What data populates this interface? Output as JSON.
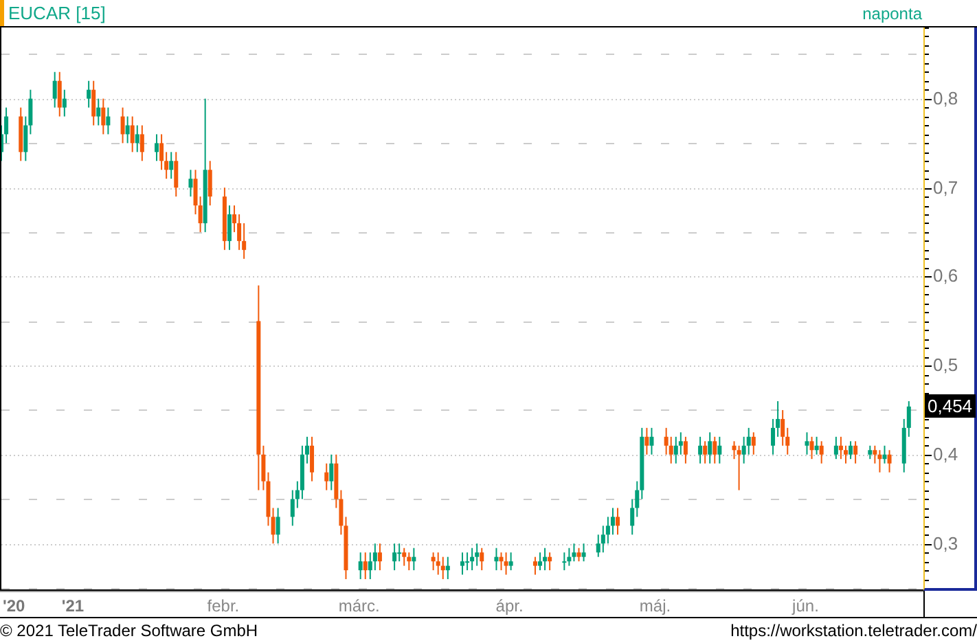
{
  "header": {
    "symbol": "EUCAR [15]",
    "interval": "naponta"
  },
  "chart": {
    "last_price": "0,454",
    "chart_data": {
      "type": "candlestick",
      "x": [
        "2020-12-17",
        "2020-12-18",
        "2020-12-21",
        "2020-12-22",
        "2020-12-23",
        "2020-12-28",
        "2020-12-29",
        "2020-12-30",
        "2021-01-04",
        "2021-01-05",
        "2021-01-06",
        "2021-01-07",
        "2021-01-08",
        "2021-01-11",
        "2021-01-12",
        "2021-01-13",
        "2021-01-14",
        "2021-01-15",
        "2021-01-18",
        "2021-01-19",
        "2021-01-20",
        "2021-01-21",
        "2021-01-22",
        "2021-01-25",
        "2021-01-26",
        "2021-01-27",
        "2021-01-28",
        "2021-01-29",
        "2021-02-01",
        "2021-02-02",
        "2021-02-03",
        "2021-02-04",
        "2021-02-05",
        "2021-02-08",
        "2021-02-09",
        "2021-02-10",
        "2021-02-11",
        "2021-02-12",
        "2021-02-15",
        "2021-02-16",
        "2021-02-17",
        "2021-02-18",
        "2021-02-19",
        "2021-02-22",
        "2021-02-23",
        "2021-02-24",
        "2021-02-25",
        "2021-02-26",
        "2021-03-01",
        "2021-03-02",
        "2021-03-03",
        "2021-03-04",
        "2021-03-05",
        "2021-03-08",
        "2021-03-09",
        "2021-03-10",
        "2021-03-11",
        "2021-03-12",
        "2021-03-16",
        "2021-03-17",
        "2021-03-18",
        "2021-03-19",
        "2021-03-22",
        "2021-03-23",
        "2021-03-24",
        "2021-03-25",
        "2021-03-26",
        "2021-03-29",
        "2021-03-30",
        "2021-03-31",
        "2021-04-01",
        "2021-04-06",
        "2021-04-07",
        "2021-04-08",
        "2021-04-09",
        "2021-04-12",
        "2021-04-13",
        "2021-04-14",
        "2021-04-15",
        "2021-04-16",
        "2021-04-19",
        "2021-04-20",
        "2021-04-21",
        "2021-04-22",
        "2021-04-23",
        "2021-04-26",
        "2021-04-27",
        "2021-04-28",
        "2021-04-29",
        "2021-04-30",
        "2021-05-03",
        "2021-05-04",
        "2021-05-05",
        "2021-05-06",
        "2021-05-07",
        "2021-05-10",
        "2021-05-11",
        "2021-05-12",
        "2021-05-13",
        "2021-05-14",
        "2021-05-17",
        "2021-05-18",
        "2021-05-19",
        "2021-05-20",
        "2021-05-21",
        "2021-05-25",
        "2021-05-26",
        "2021-05-27",
        "2021-05-28",
        "2021-06-01",
        "2021-06-02",
        "2021-06-03",
        "2021-06-04",
        "2021-06-07",
        "2021-06-08",
        "2021-06-09",
        "2021-06-10",
        "2021-06-11",
        "2021-06-14",
        "2021-06-15",
        "2021-06-16",
        "2021-06-17",
        "2021-06-18",
        "2021-06-21",
        "2021-06-22"
      ],
      "xlim": [
        "2020-12-17",
        "2021-06-25"
      ],
      "grid": true,
      "ohlc": [
        [
          0.74,
          0.77,
          0.73,
          0.76
        ],
        [
          0.76,
          0.79,
          0.75,
          0.78
        ],
        [
          0.78,
          0.79,
          0.73,
          0.74
        ],
        [
          0.74,
          0.78,
          0.73,
          0.77
        ],
        [
          0.77,
          0.81,
          0.76,
          0.8
        ],
        [
          0.8,
          0.83,
          0.79,
          0.82
        ],
        [
          0.82,
          0.83,
          0.78,
          0.79
        ],
        [
          0.79,
          0.81,
          0.78,
          0.8
        ],
        [
          0.8,
          0.82,
          0.79,
          0.81
        ],
        [
          0.81,
          0.82,
          0.77,
          0.78
        ],
        [
          0.78,
          0.8,
          0.77,
          0.79
        ],
        [
          0.79,
          0.8,
          0.76,
          0.77
        ],
        [
          0.77,
          0.79,
          0.76,
          0.78
        ],
        [
          0.78,
          0.79,
          0.75,
          0.76
        ],
        [
          0.76,
          0.78,
          0.75,
          0.77
        ],
        [
          0.77,
          0.78,
          0.74,
          0.75
        ],
        [
          0.75,
          0.77,
          0.74,
          0.76
        ],
        [
          0.76,
          0.77,
          0.73,
          0.74
        ],
        [
          0.74,
          0.76,
          0.73,
          0.75
        ],
        [
          0.75,
          0.76,
          0.72,
          0.73
        ],
        [
          0.73,
          0.74,
          0.71,
          0.72
        ],
        [
          0.72,
          0.74,
          0.71,
          0.73
        ],
        [
          0.73,
          0.74,
          0.69,
          0.7
        ],
        [
          0.7,
          0.72,
          0.69,
          0.71
        ],
        [
          0.71,
          0.72,
          0.67,
          0.68
        ],
        [
          0.68,
          0.69,
          0.65,
          0.66
        ],
        [
          0.66,
          0.8,
          0.65,
          0.72
        ],
        [
          0.72,
          0.73,
          0.68,
          0.69
        ],
        [
          0.69,
          0.7,
          0.63,
          0.64
        ],
        [
          0.64,
          0.68,
          0.63,
          0.67
        ],
        [
          0.67,
          0.68,
          0.65,
          0.66
        ],
        [
          0.66,
          0.67,
          0.63,
          0.64
        ],
        [
          0.64,
          0.66,
          0.62,
          0.63
        ],
        [
          0.55,
          0.59,
          0.36,
          0.4
        ],
        [
          0.4,
          0.41,
          0.36,
          0.37
        ],
        [
          0.37,
          0.38,
          0.32,
          0.33
        ],
        [
          0.33,
          0.34,
          0.3,
          0.31
        ],
        [
          0.31,
          0.34,
          0.3,
          0.33
        ],
        [
          0.33,
          0.36,
          0.32,
          0.35
        ],
        [
          0.35,
          0.37,
          0.34,
          0.36
        ],
        [
          0.36,
          0.41,
          0.35,
          0.4
        ],
        [
          0.4,
          0.42,
          0.39,
          0.41
        ],
        [
          0.41,
          0.42,
          0.37,
          0.38
        ],
        [
          0.38,
          0.39,
          0.36,
          0.37
        ],
        [
          0.37,
          0.4,
          0.36,
          0.39
        ],
        [
          0.39,
          0.4,
          0.34,
          0.35
        ],
        [
          0.35,
          0.36,
          0.31,
          0.32
        ],
        [
          0.32,
          0.33,
          0.26,
          0.27
        ],
        [
          0.27,
          0.29,
          0.26,
          0.28
        ],
        [
          0.28,
          0.29,
          0.26,
          0.27
        ],
        [
          0.27,
          0.29,
          0.26,
          0.28
        ],
        [
          0.28,
          0.3,
          0.27,
          0.29
        ],
        [
          0.29,
          0.3,
          0.27,
          0.28
        ],
        [
          0.28,
          0.3,
          0.27,
          0.29
        ],
        [
          0.29,
          0.3,
          0.28,
          0.29
        ],
        [
          0.29,
          0.295,
          0.275,
          0.285
        ],
        [
          0.285,
          0.29,
          0.27,
          0.28
        ],
        [
          0.28,
          0.295,
          0.27,
          0.285
        ],
        [
          0.285,
          0.29,
          0.27,
          0.28
        ],
        [
          0.28,
          0.29,
          0.265,
          0.275
        ],
        [
          0.275,
          0.285,
          0.26,
          0.27
        ],
        [
          0.27,
          0.285,
          0.26,
          0.275
        ],
        [
          0.275,
          0.29,
          0.265,
          0.28
        ],
        [
          0.28,
          0.29,
          0.27,
          0.28
        ],
        [
          0.28,
          0.295,
          0.27,
          0.285
        ],
        [
          0.285,
          0.3,
          0.275,
          0.29
        ],
        [
          0.29,
          0.295,
          0.27,
          0.28
        ],
        [
          0.28,
          0.295,
          0.27,
          0.285
        ],
        [
          0.285,
          0.29,
          0.27,
          0.28
        ],
        [
          0.28,
          0.29,
          0.265,
          0.275
        ],
        [
          0.275,
          0.29,
          0.27,
          0.28
        ],
        [
          0.28,
          0.285,
          0.265,
          0.275
        ],
        [
          0.275,
          0.29,
          0.27,
          0.28
        ],
        [
          0.28,
          0.295,
          0.27,
          0.285
        ],
        [
          0.285,
          0.29,
          0.27,
          0.28
        ],
        [
          0.28,
          0.29,
          0.27,
          0.28
        ],
        [
          0.28,
          0.295,
          0.275,
          0.285
        ],
        [
          0.285,
          0.3,
          0.28,
          0.29
        ],
        [
          0.29,
          0.295,
          0.28,
          0.285
        ],
        [
          0.285,
          0.3,
          0.28,
          0.29
        ],
        [
          0.29,
          0.31,
          0.285,
          0.3
        ],
        [
          0.3,
          0.32,
          0.29,
          0.31
        ],
        [
          0.31,
          0.33,
          0.3,
          0.32
        ],
        [
          0.32,
          0.34,
          0.31,
          0.33
        ],
        [
          0.33,
          0.34,
          0.31,
          0.32
        ],
        [
          0.32,
          0.35,
          0.31,
          0.34
        ],
        [
          0.34,
          0.37,
          0.33,
          0.36
        ],
        [
          0.36,
          0.43,
          0.35,
          0.42
        ],
        [
          0.42,
          0.43,
          0.4,
          0.41
        ],
        [
          0.41,
          0.43,
          0.4,
          0.42
        ],
        [
          0.42,
          0.43,
          0.4,
          0.41
        ],
        [
          0.41,
          0.42,
          0.39,
          0.4
        ],
        [
          0.4,
          0.42,
          0.39,
          0.41
        ],
        [
          0.41,
          0.425,
          0.4,
          0.415
        ],
        [
          0.415,
          0.42,
          0.39,
          0.4
        ],
        [
          0.4,
          0.42,
          0.39,
          0.41
        ],
        [
          0.41,
          0.415,
          0.39,
          0.4
        ],
        [
          0.4,
          0.425,
          0.39,
          0.415
        ],
        [
          0.415,
          0.42,
          0.39,
          0.4
        ],
        [
          0.4,
          0.42,
          0.39,
          0.41
        ],
        [
          0.41,
          0.415,
          0.395,
          0.405
        ],
        [
          0.405,
          0.41,
          0.36,
          0.4
        ],
        [
          0.4,
          0.42,
          0.39,
          0.41
        ],
        [
          0.41,
          0.43,
          0.4,
          0.42
        ],
        [
          0.42,
          0.425,
          0.4,
          0.41
        ],
        [
          0.41,
          0.44,
          0.4,
          0.43
        ],
        [
          0.43,
          0.46,
          0.42,
          0.44
        ],
        [
          0.44,
          0.45,
          0.41,
          0.42
        ],
        [
          0.42,
          0.43,
          0.4,
          0.41
        ],
        [
          0.41,
          0.425,
          0.4,
          0.415
        ],
        [
          0.415,
          0.42,
          0.395,
          0.405
        ],
        [
          0.405,
          0.42,
          0.4,
          0.41
        ],
        [
          0.41,
          0.415,
          0.39,
          0.4
        ],
        [
          0.4,
          0.42,
          0.395,
          0.41
        ],
        [
          0.41,
          0.42,
          0.395,
          0.405
        ],
        [
          0.405,
          0.41,
          0.39,
          0.4
        ],
        [
          0.4,
          0.415,
          0.395,
          0.41
        ],
        [
          0.41,
          0.415,
          0.39,
          0.4
        ],
        [
          0.4,
          0.41,
          0.395,
          0.405
        ],
        [
          0.405,
          0.41,
          0.39,
          0.4
        ],
        [
          0.4,
          0.405,
          0.38,
          0.395
        ],
        [
          0.395,
          0.41,
          0.39,
          0.4
        ],
        [
          0.4,
          0.405,
          0.38,
          0.39
        ],
        [
          0.39,
          0.44,
          0.38,
          0.43
        ],
        [
          0.43,
          0.46,
          0.42,
          0.454
        ]
      ],
      "ylim": [
        0.25,
        0.88
      ],
      "yticks": [
        {
          "value": 0.8,
          "label": "0,8"
        },
        {
          "value": 0.7,
          "label": "0,7"
        },
        {
          "value": 0.6,
          "label": "0,6"
        },
        {
          "value": 0.5,
          "label": "0,5"
        },
        {
          "value": 0.4,
          "label": "0,4"
        },
        {
          "value": 0.3,
          "label": "0,3"
        }
      ],
      "xticks": [
        {
          "value": "2020-12-17",
          "label": "'20"
        },
        {
          "value": "2021-01-01",
          "label": "'21"
        },
        {
          "value": "2021-02-01",
          "label": "febr."
        },
        {
          "value": "2021-03-01",
          "label": "márc."
        },
        {
          "value": "2021-04-01",
          "label": "ápr."
        },
        {
          "value": "2021-05-01",
          "label": "máj."
        },
        {
          "value": "2021-06-01",
          "label": "jún."
        }
      ]
    }
  },
  "footer": {
    "copyright": "© 2021 TeleTrader Software GmbH",
    "url": "https://workstation.teletrader.com/"
  }
}
